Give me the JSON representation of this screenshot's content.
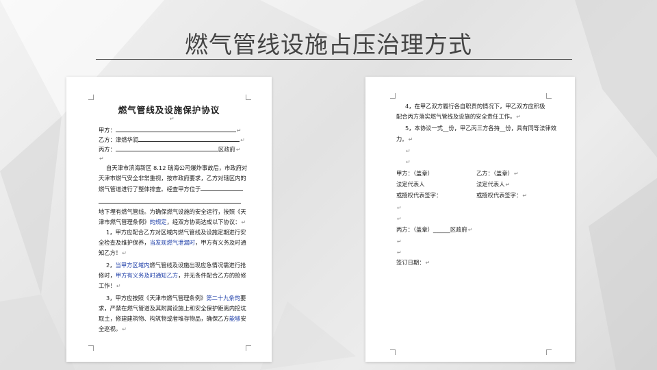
{
  "slide": {
    "title": "燃气管线设施占压治理方式"
  },
  "left_page": {
    "doc_title": "燃气管线及设施保护协议",
    "party_a": "甲方：",
    "party_b": "乙方：津燃华润",
    "party_c": "丙方：",
    "party_c_suffix": "区政府",
    "para1_line1": "自天津市滨海新区 8.12 瑞海公司爆炸事故后，市政府对",
    "para1_line2": "天津市燃气安全非常重视，按市政府要求，乙方对辖区内的",
    "para1_line3": "燃气管道进行了整体排查。经查甲方位于",
    "para2_line1": "地下埋有燃气管线。为确保燃气设施的安全运行，按照《天",
    "para2_line2a": "津市燃气管理条例》",
    "para2_line2b": "的规定",
    "para2_line2c": "，经双方协商达成以下协议：",
    "item1_line1": "1，甲方应配合乙方对区域内燃气管线及设施定期进行安",
    "item1_line2a": "全检查及维护保养，",
    "item1_line2b": "当发现燃气泄漏时",
    "item1_line2c": "，甲方有义务及时通",
    "item1_line3": "知乙方！",
    "item2_line1a": "2，",
    "item2_line1b": "当甲方区域内",
    "item2_line1c": "燃气管线及设施出现应急情况需进行抢",
    "item2_line2a": "修时，",
    "item2_line2b": "甲方有义务及时通知乙方",
    "item2_line2c": "，并无条件配合乙方的抢修",
    "item2_line3": "工作！",
    "item3_line1a": "3，甲方应按照《天津市燃气管理条例》",
    "item3_line1b": "第二十九条的",
    "item3_line1c": "要",
    "item3_line2": "求，严禁在燃气管道及其附属设施上和安全保护距离内挖坑",
    "item3_line3": "取土，修建建筑物、构筑物或者堆存物品，确保乙方",
    "item3_line3b": "能够",
    "item3_line3c": "安",
    "item3_line4": "全巡视。"
  },
  "right_page": {
    "item4_line1": "4，在甲乙双方履行各自职责的情况下，甲乙双方应积极",
    "item4_line2": "配合丙方落实燃气管线及设施的安全责任工作。",
    "item5_line1": "5，本协议一式__份，甲乙丙三方各持__份，具有同等法律效",
    "item5_line2": "力。",
    "party_a_seal": "甲方：（盖章）",
    "party_b_seal": "乙方：（盖章）",
    "legal_rep_a": "法定代表人",
    "legal_rep_b": "法定代表人",
    "auth_rep_a": "或授权代表签字：",
    "auth_rep_b": "或授权代表签字：",
    "party_c_seal": "丙方：（盖章）______区政府",
    "sign_date": "签订日期："
  },
  "colors": {
    "highlight_text": "#1f3fa8",
    "title_text": "#444444"
  }
}
